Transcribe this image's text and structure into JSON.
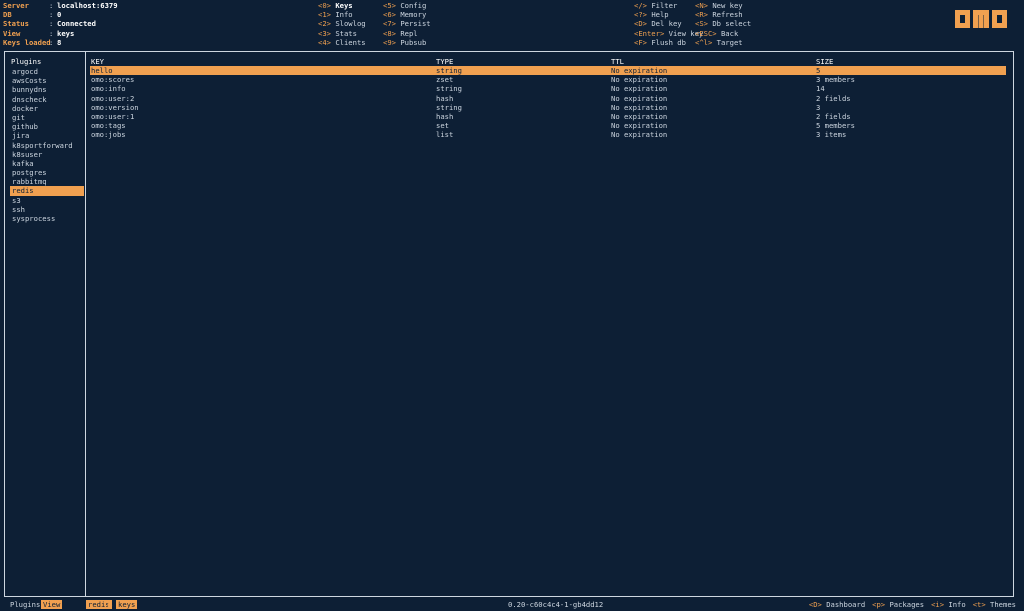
{
  "header": {
    "info": [
      {
        "label": "Server",
        "value": "localhost:6379"
      },
      {
        "label": "DB",
        "value": "0"
      },
      {
        "label": "Status",
        "value": "Connected"
      },
      {
        "label": "View",
        "value": "keys"
      },
      {
        "label": "Keys loaded",
        "value": "8"
      }
    ],
    "hotkeys_col1": [
      {
        "key": "<0>",
        "label": "Keys"
      },
      {
        "key": "<1>",
        "label": "Info"
      },
      {
        "key": "<2>",
        "label": "Slowlog"
      },
      {
        "key": "<3>",
        "label": "Stats"
      },
      {
        "key": "<4>",
        "label": "Clients"
      }
    ],
    "hotkeys_col2": [
      {
        "key": "<5>",
        "label": "Config"
      },
      {
        "key": "<6>",
        "label": "Memory"
      },
      {
        "key": "<7>",
        "label": "Persist"
      },
      {
        "key": "<8>",
        "label": "Repl"
      },
      {
        "key": "<9>",
        "label": "Pubsub"
      }
    ],
    "hotkeys_col3": [
      {
        "key": "</>",
        "label": "Filter"
      },
      {
        "key": "<?>",
        "label": "Help"
      },
      {
        "key": "<D>",
        "label": "Del key"
      },
      {
        "key": "<Enter>",
        "label": "View key"
      },
      {
        "key": "<F>",
        "label": "Flush db"
      }
    ],
    "hotkeys_col4": [
      {
        "key": "<N>",
        "label": "New key"
      },
      {
        "key": "<R>",
        "label": "Refresh"
      },
      {
        "key": "<S>",
        "label": "Db select"
      },
      {
        "key": "<ESC>",
        "label": "Back"
      },
      {
        "key": "<^l>",
        "label": "Target"
      }
    ]
  },
  "sidebar": {
    "title": "Plugins",
    "items": [
      "argocd",
      "awsCosts",
      "bunnydns",
      "dnscheck",
      "docker",
      "git",
      "github",
      "jira",
      "k8sportforward",
      "k8suser",
      "kafka",
      "postgres",
      "rabbitmq",
      "redis",
      "s3",
      "ssh",
      "sysprocess"
    ],
    "active": "redis"
  },
  "table": {
    "columns": [
      "KEY",
      "TYPE",
      "TTL",
      "SIZE"
    ],
    "rows": [
      [
        "hello",
        "string",
        "No expiration",
        "5"
      ],
      [
        "omo:scores",
        "zset",
        "No expiration",
        "3 members"
      ],
      [
        "omo:info",
        "string",
        "No expiration",
        "14"
      ],
      [
        "omo:user:2",
        "hash",
        "No expiration",
        "2 fields"
      ],
      [
        "omo:version",
        "string",
        "No expiration",
        "3"
      ],
      [
        "omo:user:1",
        "hash",
        "No expiration",
        "2 fields"
      ],
      [
        "omo:tags",
        "set",
        "No expiration",
        "5 members"
      ],
      [
        "omo:jobs",
        "list",
        "No expiration",
        "3 items"
      ]
    ],
    "selected_row": 0
  },
  "footer": {
    "crumb_plugins": "Plugins",
    "crumb_view": "View",
    "crumb_redis": "redis",
    "crumb_keys": "keys",
    "version": "0.20-c60c4c4-1-gb4dd12",
    "keys": [
      {
        "key": "<D>",
        "label": "Dashboard"
      },
      {
        "key": "<p>",
        "label": "Packages"
      },
      {
        "key": "<i>",
        "label": "Info"
      },
      {
        "key": "<t>",
        "label": "Themes"
      }
    ]
  },
  "colors": {
    "accent": "#f0a050",
    "background": "#0d1f35",
    "text": "#cdd6e0"
  },
  "logo_text": "OMO"
}
